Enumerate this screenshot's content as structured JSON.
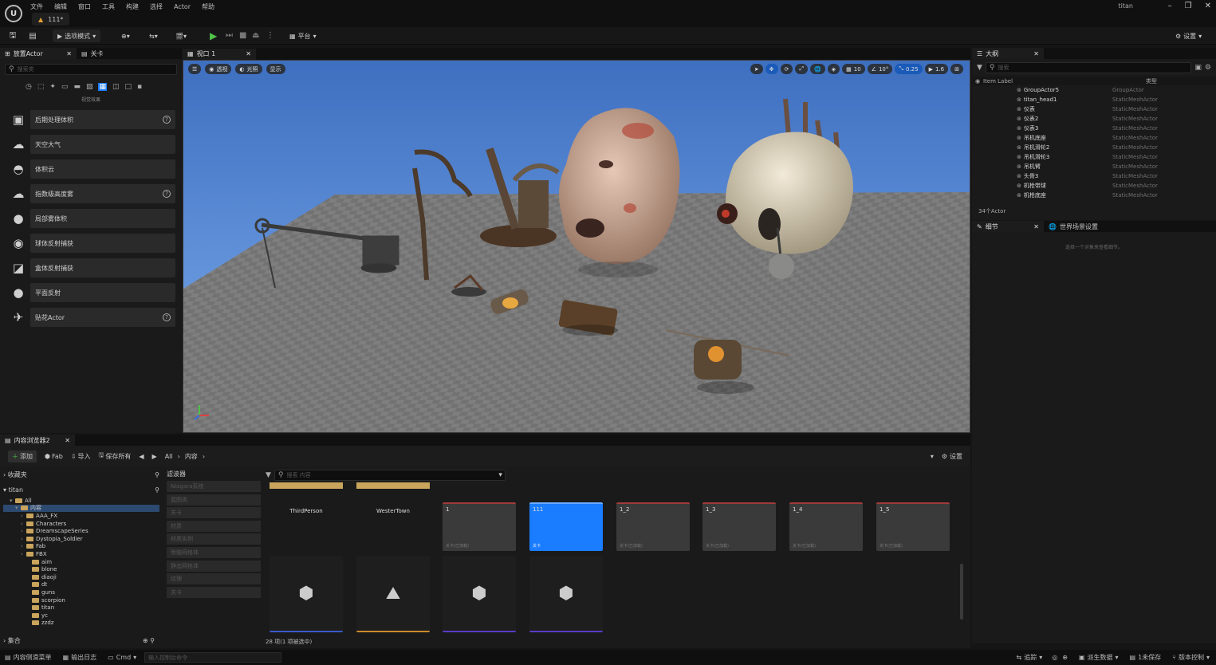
{
  "menu": [
    "文件",
    "编辑",
    "窗口",
    "工具",
    "构建",
    "选择",
    "Actor",
    "帮助"
  ],
  "project_tab": "111*",
  "user": "titan",
  "toolbar": {
    "mode": "选项模式",
    "platform": "平台",
    "settings": "设置"
  },
  "left_tabs": [
    "放置Actor",
    "关卡"
  ],
  "left_search_placeholder": "搜索类",
  "left_category": "视觉效果",
  "actors": [
    {
      "label": "后期处理体积",
      "icon": "▣",
      "help": true
    },
    {
      "label": "天空大气",
      "icon": "☁",
      "help": false
    },
    {
      "label": "体积云",
      "icon": "◓",
      "help": false
    },
    {
      "label": "指数级高度雾",
      "icon": "☁",
      "help": true
    },
    {
      "label": "局部雾体积",
      "icon": "●",
      "help": false
    },
    {
      "label": "球体反射捕获",
      "icon": "◉",
      "help": false
    },
    {
      "label": "盒体反射捕获",
      "icon": "◪",
      "help": false
    },
    {
      "label": "平面反射",
      "icon": "●",
      "help": false
    },
    {
      "label": "贴花Actor",
      "icon": "✈",
      "help": true
    }
  ],
  "viewport": {
    "tab": "视口 1",
    "buttons": [
      "透视",
      "光照",
      "显示"
    ],
    "grid": "10",
    "angle": "10°",
    "scale": "0.25",
    "speed": "1.6"
  },
  "outliner": {
    "tab": "大纲",
    "search_placeholder": "搜索",
    "col_label": "Item Label",
    "col_type": "类型",
    "rows": [
      {
        "name": "GroupActor5",
        "type": "GroupActor"
      },
      {
        "name": "titan_head1",
        "type": "StaticMeshActor"
      },
      {
        "name": "仪表",
        "type": "StaticMeshActor"
      },
      {
        "name": "仪表2",
        "type": "StaticMeshActor"
      },
      {
        "name": "仪表3",
        "type": "StaticMeshActor"
      },
      {
        "name": "吊机底座",
        "type": "StaticMeshActor"
      },
      {
        "name": "吊机滑轮2",
        "type": "StaticMeshActor"
      },
      {
        "name": "吊机滑轮3",
        "type": "StaticMeshActor"
      },
      {
        "name": "吊机臂",
        "type": "StaticMeshActor"
      },
      {
        "name": "头骨3",
        "type": "StaticMeshActor"
      },
      {
        "name": "机枪带球",
        "type": "StaticMeshActor"
      },
      {
        "name": "机枪底座",
        "type": "StaticMeshActor"
      }
    ],
    "count": "34个Actor"
  },
  "details": {
    "tab": "细节",
    "world_tab": "世界场景设置",
    "hint": "选择一个对象来查看细节。"
  },
  "cb": {
    "tab": "内容浏览器2",
    "add": "添加",
    "fab": "Fab",
    "import": "导入",
    "save_all": "保存所有",
    "path": [
      "All",
      "内容"
    ],
    "settings": "设置",
    "favorites": "收藏夹",
    "root": "titan",
    "tree": [
      {
        "name": "All",
        "depth": 0
      },
      {
        "name": "内容",
        "depth": 1
      },
      {
        "name": "AAA_FX",
        "depth": 2
      },
      {
        "name": "Characters",
        "depth": 2
      },
      {
        "name": "DreamscapeSeries",
        "depth": 2
      },
      {
        "name": "Dystopia_Soldier",
        "depth": 2
      },
      {
        "name": "Fab",
        "depth": 2
      },
      {
        "name": "FBX",
        "depth": 2
      },
      {
        "name": "aim",
        "depth": 3
      },
      {
        "name": "blone",
        "depth": 3
      },
      {
        "name": "diaoji",
        "depth": 3
      },
      {
        "name": "dt",
        "depth": 3
      },
      {
        "name": "guns",
        "depth": 3
      },
      {
        "name": "scorpion",
        "depth": 3
      },
      {
        "name": "titan",
        "depth": 3
      },
      {
        "name": "yc",
        "depth": 3
      },
      {
        "name": "zzdz",
        "depth": 3
      }
    ],
    "collections": "集合",
    "filters_title": "滤波器",
    "filters": [
      "Niagara系统",
      "蓝图类",
      "关卡",
      "材质",
      "材质实例",
      "骨骼网格体",
      "静态网格体",
      "纹理",
      "关卡"
    ],
    "search_placeholder": "搜索 内容",
    "folders": [
      "ThirdPerson",
      "WesterTown"
    ],
    "levels": [
      {
        "name": "1",
        "sub": "关卡(已加载)",
        "selected": false
      },
      {
        "name": "111",
        "sub": "关卡",
        "selected": true
      },
      {
        "name": "1_2",
        "sub": "关卡(已加载)",
        "selected": false
      },
      {
        "name": "1_3",
        "sub": "关卡(已加载)",
        "selected": false
      },
      {
        "name": "1_4",
        "sub": "关卡(已加载)",
        "selected": false
      },
      {
        "name": "1_5",
        "sub": "关卡(已加载)",
        "selected": false
      }
    ],
    "status": "28 项(1 项被选中)"
  },
  "statusbar": {
    "drawer": "内容侧滑菜单",
    "log": "输出日志",
    "cmd": "Cmd",
    "console_placeholder": "输入控制台命令",
    "trace": "追踪",
    "derived": "派生数据",
    "unsaved": "1未保存",
    "revision": "版本控制"
  },
  "colors": {
    "accent_blue": "#1a7cff",
    "play_green": "#4fc24a",
    "folder_yellow": "#c9a45c",
    "level_red": "#a03a3a"
  }
}
